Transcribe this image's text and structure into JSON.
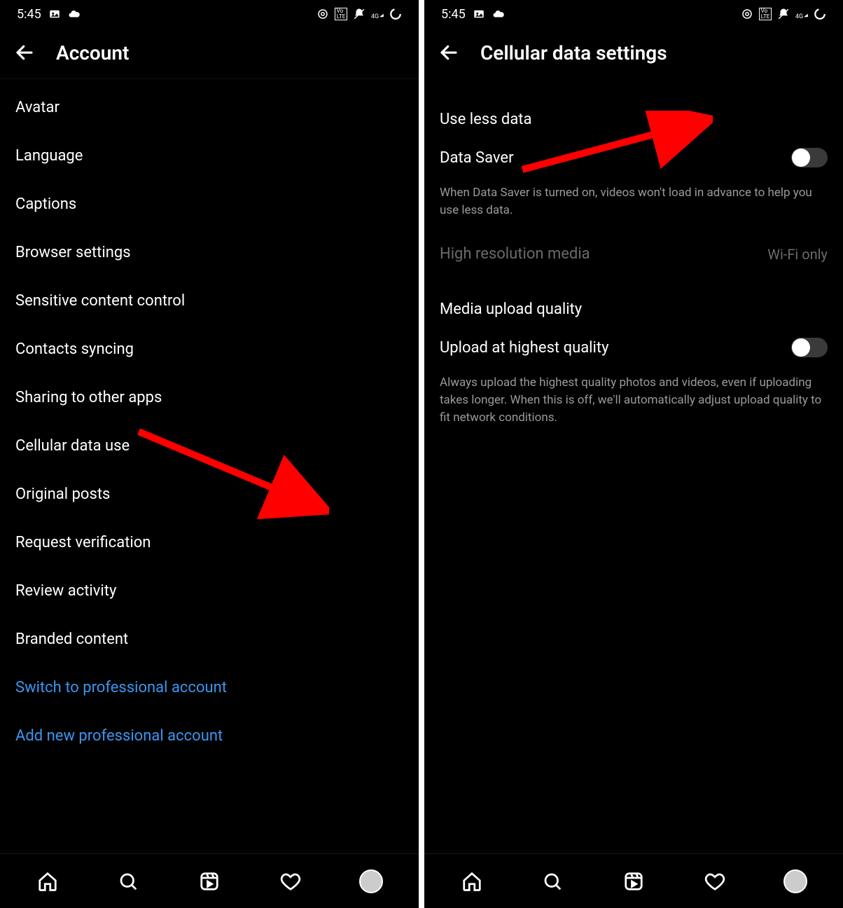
{
  "status": {
    "time": "5:45",
    "network_label": "4G",
    "volte_label": "Vo LTE"
  },
  "left": {
    "header": {
      "title": "Account"
    },
    "items": [
      {
        "label": "Avatar",
        "link": false
      },
      {
        "label": "Language",
        "link": false
      },
      {
        "label": "Captions",
        "link": false
      },
      {
        "label": "Browser settings",
        "link": false
      },
      {
        "label": "Sensitive content control",
        "link": false
      },
      {
        "label": "Contacts syncing",
        "link": false
      },
      {
        "label": "Sharing to other apps",
        "link": false
      },
      {
        "label": "Cellular data use",
        "link": false
      },
      {
        "label": "Original posts",
        "link": false
      },
      {
        "label": "Request verification",
        "link": false
      },
      {
        "label": "Review activity",
        "link": false
      },
      {
        "label": "Branded content",
        "link": false
      },
      {
        "label": "Switch to professional account",
        "link": true
      },
      {
        "label": "Add new professional account",
        "link": true
      }
    ]
  },
  "right": {
    "header": {
      "title": "Cellular data settings"
    },
    "sections": {
      "use_less_data": {
        "title": "Use less data",
        "data_saver_label": "Data Saver",
        "data_saver_on": false,
        "data_saver_description": "When Data Saver is turned on, videos won't load in advance to help you use less data.",
        "high_res_label": "High resolution media",
        "high_res_value": "Wi-Fi only"
      },
      "media_upload": {
        "title": "Media upload quality",
        "upload_label": "Upload at highest quality",
        "upload_on": false,
        "upload_description": "Always upload the highest quality photos and videos, even if uploading takes longer. When this is off, we'll automatically adjust upload quality to fit network conditions."
      }
    }
  },
  "annotations": {
    "arrow_color": "#ff0000"
  }
}
